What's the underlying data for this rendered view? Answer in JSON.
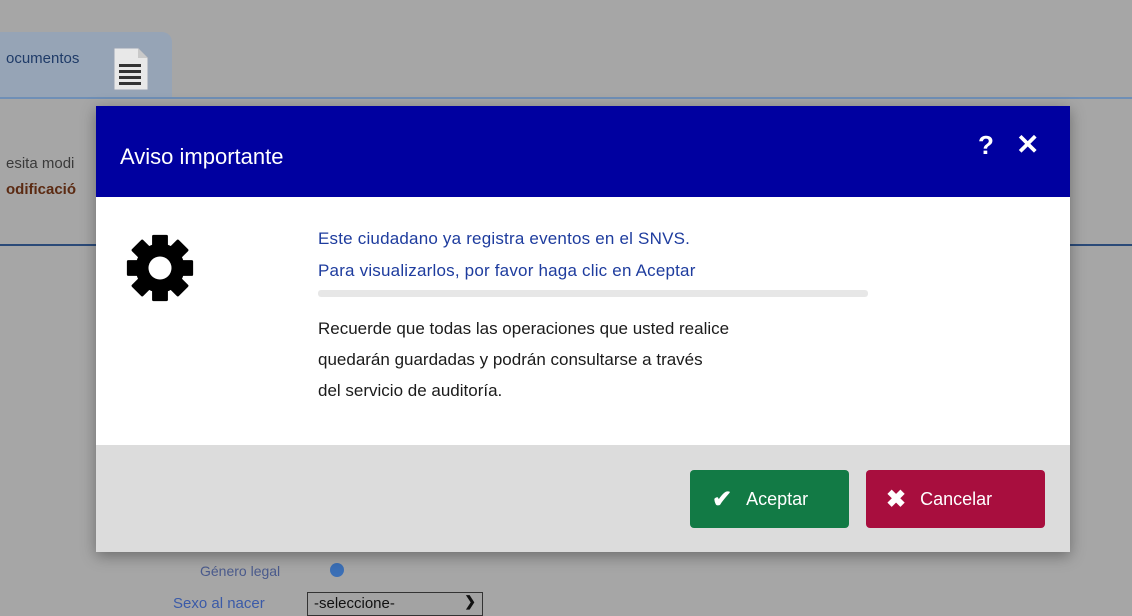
{
  "background": {
    "tab_label": "ocumentos",
    "text_line1": "esita modi",
    "text_line2": "odificació",
    "sexo_label": "Sexo al nacer",
    "sexo_select_value": "-seleccione-",
    "hidden_label": "Género legal"
  },
  "modal": {
    "title": "Aviso importante",
    "help_label": "?",
    "close_label": "✕",
    "message_line1": "Este ciudadano ya registra eventos en el SNVS.",
    "message_line2": "Para visualizarlos, por favor haga clic en Aceptar",
    "progress": 0,
    "body_line1": "Recuerde que todas las operaciones que usted realice",
    "body_line2": "quedarán guardadas y podrán consultarse a través",
    "body_line3": "del servicio de auditoría.",
    "accept_label": "Aceptar",
    "cancel_label": "Cancelar",
    "icons": {
      "main": "gear-icon",
      "accept": "checkmark-icon",
      "cancel": "x-icon",
      "tab": "document-icon"
    }
  },
  "colors": {
    "header": "#0000a0",
    "accept": "#127a45",
    "cancel": "#a80e3e",
    "message_text": "#1e3c9e"
  }
}
